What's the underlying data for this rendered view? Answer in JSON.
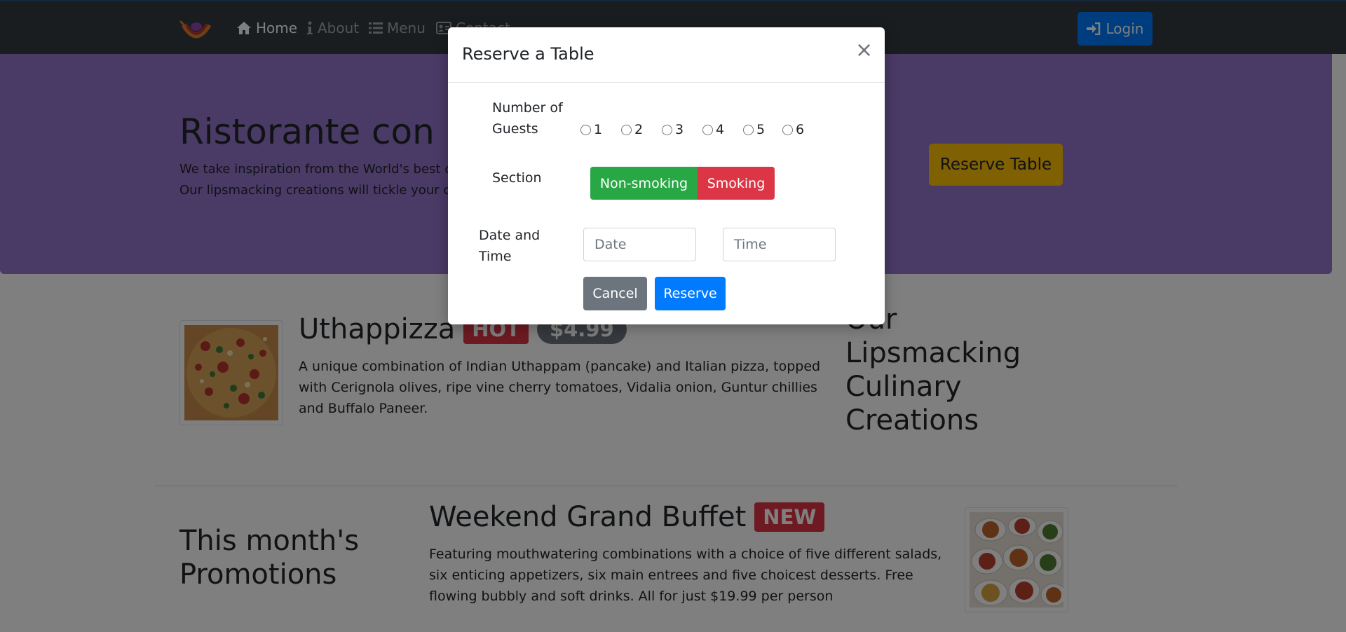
{
  "navbar": {
    "items": [
      {
        "label": "Home",
        "icon": "home-icon",
        "active": true
      },
      {
        "label": "About",
        "icon": "info-icon",
        "active": false
      },
      {
        "label": "Menu",
        "icon": "list-icon",
        "active": false
      },
      {
        "label": "Contact",
        "icon": "address-card-icon",
        "active": false
      }
    ],
    "login_label": "Login"
  },
  "jumbotron": {
    "title": "Ristorante con Fusion",
    "text": "We take inspiration from the World's best cuisines, and create a unique fusion experience. Our lipsmacking creations will tickle your culinary senses!",
    "reserve_label": "Reserve Table"
  },
  "featured": {
    "name": "Uthappizza",
    "badge": "HOT",
    "price": "$4.99",
    "description": "A unique combination of Indian Uthappam (pancake) and Italian pizza, topped with Cerignola olives, ripe vine cherry tomatoes, Vidalia onion, Guntur chillies and Buffalo Paneer.",
    "side_heading": "Our Lipsmacking Culinary Creations"
  },
  "promotion": {
    "heading": "This month's Promotions",
    "name": "Weekend Grand Buffet",
    "badge": "NEW",
    "description": "Featuring mouthwatering combinations with a choice of five different salads, six enticing appetizers, six main entrees and five choicest desserts. Free flowing bubbly and soft drinks. All for just $19.99 per person"
  },
  "modal": {
    "title": "Reserve a Table",
    "close_symbol": "×",
    "guests_label": "Number of Guests",
    "guest_options": [
      "1",
      "2",
      "3",
      "4",
      "5",
      "6"
    ],
    "section_label": "Section",
    "section_options": [
      "Non-smoking",
      "Smoking"
    ],
    "datetime_label": "Date and Time",
    "date_placeholder": "Date",
    "time_placeholder": "Time",
    "cancel_label": "Cancel",
    "reserve_label": "Reserve"
  },
  "colors": {
    "navbar": "#343a40",
    "jumbotron": "#9575cd",
    "primary": "#007bff",
    "warning": "#ffc107",
    "success": "#28a745",
    "danger": "#dc3545",
    "secondary": "#6c757d"
  }
}
